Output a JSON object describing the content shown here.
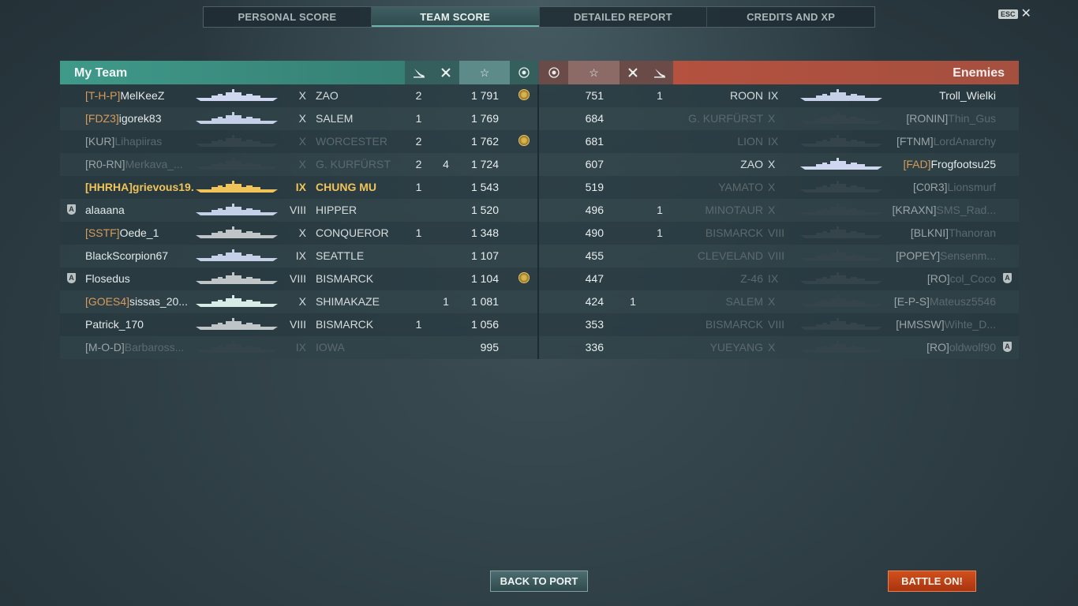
{
  "tabs": [
    {
      "label": "PERSONAL SCORE",
      "active": false
    },
    {
      "label": "TEAM SCORE",
      "active": true
    },
    {
      "label": "DETAILED REPORT",
      "active": false
    },
    {
      "label": "CREDITS AND XP",
      "active": false
    }
  ],
  "esc": {
    "key": "ESC",
    "close": "✕"
  },
  "my_team": {
    "title": "My Team",
    "header_icons": [
      "torpedo-icon",
      "plane-icon",
      "star-icon",
      "medal-icon"
    ],
    "rows": [
      {
        "clan": "[T-H-P]",
        "name": "MelKeeZ",
        "tier": "X",
        "ship": "ZAO",
        "c1": "2",
        "c2": "",
        "score": "1 791",
        "medal": true,
        "badge": false,
        "state": "alive",
        "ship_color": "#cfd6f0"
      },
      {
        "clan": "[FDZ3]",
        "name": "igorek83",
        "tier": "X",
        "ship": "SALEM",
        "c1": "1",
        "c2": "",
        "score": "1 769",
        "medal": false,
        "badge": false,
        "state": "alive",
        "ship_color": "#c6cfe8"
      },
      {
        "clan": "[KUR]",
        "name": "Lihapiiras",
        "tier": "X",
        "ship": "WORCESTER",
        "c1": "2",
        "c2": "",
        "score": "1 762",
        "medal": true,
        "badge": false,
        "state": "dead",
        "ship_color": "#34444a"
      },
      {
        "clan": "[R0-RN]",
        "name": "Merkava_...",
        "tier": "X",
        "ship": "G. KURFÜRST",
        "c1": "2",
        "c2": "4",
        "score": "1 724",
        "medal": false,
        "badge": false,
        "state": "dead",
        "ship_color": "#34444a"
      },
      {
        "clan": "[HHRHA]",
        "name": "grievous19...",
        "tier": "IX",
        "ship": "CHUNG MU",
        "c1": "1",
        "c2": "",
        "score": "1 543",
        "medal": false,
        "badge": false,
        "state": "self",
        "ship_color": "#f1c45a"
      },
      {
        "clan": "",
        "name": "alaaana",
        "tier": "VIII",
        "ship": "HIPPER",
        "c1": "",
        "c2": "",
        "score": "1 520",
        "medal": false,
        "badge": true,
        "state": "alive",
        "ship_color": "#c6cfe8"
      },
      {
        "clan": "[SSTF]",
        "name": "Oede_1",
        "tier": "X",
        "ship": "CONQUEROR",
        "c1": "1",
        "c2": "",
        "score": "1 348",
        "medal": false,
        "badge": false,
        "state": "alive",
        "ship_color": "#bfc4c6"
      },
      {
        "clan": "",
        "name": "BlackScorpion67",
        "tier": "IX",
        "ship": "SEATTLE",
        "c1": "",
        "c2": "",
        "score": "1 107",
        "medal": false,
        "badge": false,
        "state": "alive",
        "ship_color": "#c6cfe8"
      },
      {
        "clan": "",
        "name": "Flosedus",
        "tier": "VIII",
        "ship": "BISMARCK",
        "c1": "",
        "c2": "",
        "score": "1 104",
        "medal": true,
        "badge": true,
        "state": "alive",
        "ship_color": "#bfc4c6"
      },
      {
        "clan": "[GOES4]",
        "name": "sissas_20...",
        "tier": "X",
        "ship": "SHIMAKAZE",
        "c1": "",
        "c2": "1",
        "score": "1 081",
        "medal": false,
        "badge": false,
        "state": "alive",
        "ship_color": "#d8ece6"
      },
      {
        "clan": "",
        "name": "Patrick_170",
        "tier": "VIII",
        "ship": "BISMARCK",
        "c1": "1",
        "c2": "",
        "score": "1 056",
        "medal": false,
        "badge": false,
        "state": "alive",
        "ship_color": "#bfc4c6"
      },
      {
        "clan": "[M-O-D]",
        "name": "Barbaross...",
        "tier": "IX",
        "ship": "IOWA",
        "c1": "",
        "c2": "",
        "score": "995",
        "medal": false,
        "badge": false,
        "state": "dead",
        "ship_color": "#34444a"
      }
    ]
  },
  "enemies": {
    "title": "Enemies",
    "header_icons": [
      "medal-icon",
      "star-icon",
      "plane-icon",
      "torpedo-icon"
    ],
    "rows": [
      {
        "score": "751",
        "c2": "",
        "c1": "1",
        "ship": "ROON",
        "tier": "IX",
        "clan": "",
        "name": "Troll_Wielki",
        "badge": false,
        "state": "alive",
        "ship_color": "#c6cfe8"
      },
      {
        "score": "684",
        "c2": "",
        "c1": "",
        "ship": "G. KURFÜRST",
        "tier": "X",
        "clan": "[RONIN]",
        "name": "Thin_Gus",
        "badge": false,
        "state": "dead",
        "ship_color": "#34444a"
      },
      {
        "score": "681",
        "c2": "",
        "c1": "",
        "ship": "LION",
        "tier": "IX",
        "clan": "[FTNM]",
        "name": "LordAnarchy",
        "badge": false,
        "state": "dead",
        "ship_color": "#34444a"
      },
      {
        "score": "607",
        "c2": "",
        "c1": "",
        "ship": "ZAO",
        "tier": "X",
        "clan": "[FAD]",
        "name": "Frogfootsu25",
        "badge": false,
        "state": "alive",
        "ship_color": "#cfd6f0"
      },
      {
        "score": "519",
        "c2": "",
        "c1": "",
        "ship": "YAMATO",
        "tier": "X",
        "clan": "[C0R3]",
        "name": "Lionsmurf",
        "badge": false,
        "state": "dead",
        "ship_color": "#34444a"
      },
      {
        "score": "496",
        "c2": "",
        "c1": "1",
        "ship": "MINOTAUR",
        "tier": "X",
        "clan": "[KRAXN]",
        "name": "SMS_Rad...",
        "badge": false,
        "state": "dead",
        "ship_color": "#34444a"
      },
      {
        "score": "490",
        "c2": "",
        "c1": "1",
        "ship": "BISMARCK",
        "tier": "VIII",
        "clan": "[BLKNI]",
        "name": "Thanoran",
        "badge": false,
        "state": "dead",
        "ship_color": "#34444a"
      },
      {
        "score": "455",
        "c2": "",
        "c1": "",
        "ship": "CLEVELAND",
        "tier": "VIII",
        "clan": "[POPEY]",
        "name": "Sensenm...",
        "badge": false,
        "state": "dead",
        "ship_color": "#34444a"
      },
      {
        "score": "447",
        "c2": "",
        "c1": "",
        "ship": "Z-46",
        "tier": "IX",
        "clan": "[RO]",
        "name": "col_Coco",
        "badge": true,
        "state": "dead",
        "ship_color": "#34444a"
      },
      {
        "score": "424",
        "c2": "1",
        "c1": "",
        "ship": "SALEM",
        "tier": "X",
        "clan": "[E-P-S]",
        "name": "Mateusz5546",
        "badge": false,
        "state": "dead",
        "ship_color": "#34444a"
      },
      {
        "score": "353",
        "c2": "",
        "c1": "",
        "ship": "BISMARCK",
        "tier": "VIII",
        "clan": "[HMSSW]",
        "name": "Wihte_D...",
        "badge": false,
        "state": "dead",
        "ship_color": "#34444a"
      },
      {
        "score": "336",
        "c2": "",
        "c1": "",
        "ship": "YUEYANG",
        "tier": "X",
        "clan": "[RO]",
        "name": "oldwolf90",
        "badge": true,
        "state": "dead",
        "ship_color": "#34444a"
      }
    ]
  },
  "buttons": {
    "back": "BACK TO PORT",
    "battle": "BATTLE ON!"
  },
  "badge_letter": "A"
}
